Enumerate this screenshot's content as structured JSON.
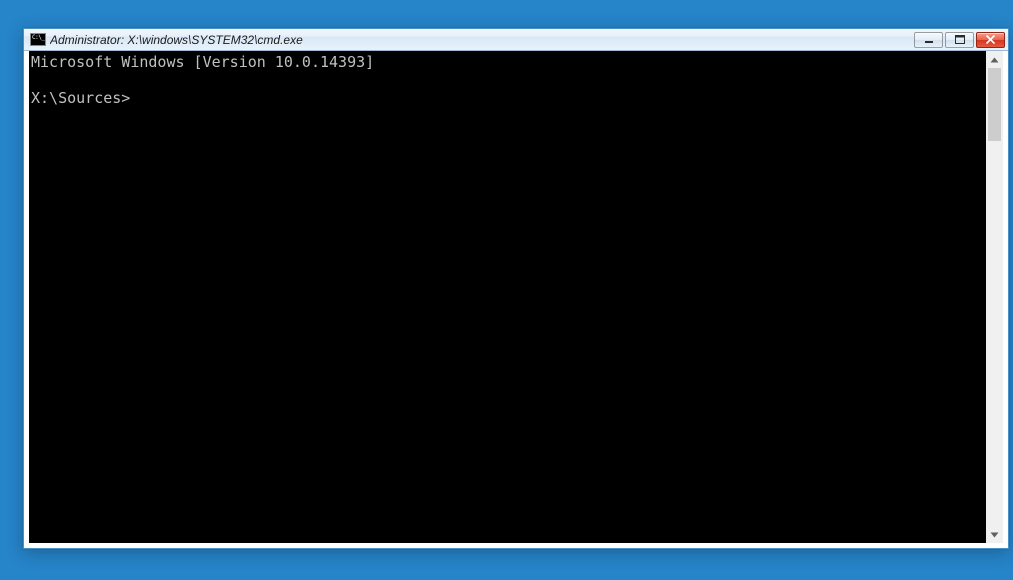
{
  "window": {
    "title": "Administrator: X:\\windows\\SYSTEM32\\cmd.exe"
  },
  "console": {
    "version_line": "Microsoft Windows [Version 10.0.14393]",
    "blank_line": "",
    "prompt": "X:\\Sources>"
  }
}
